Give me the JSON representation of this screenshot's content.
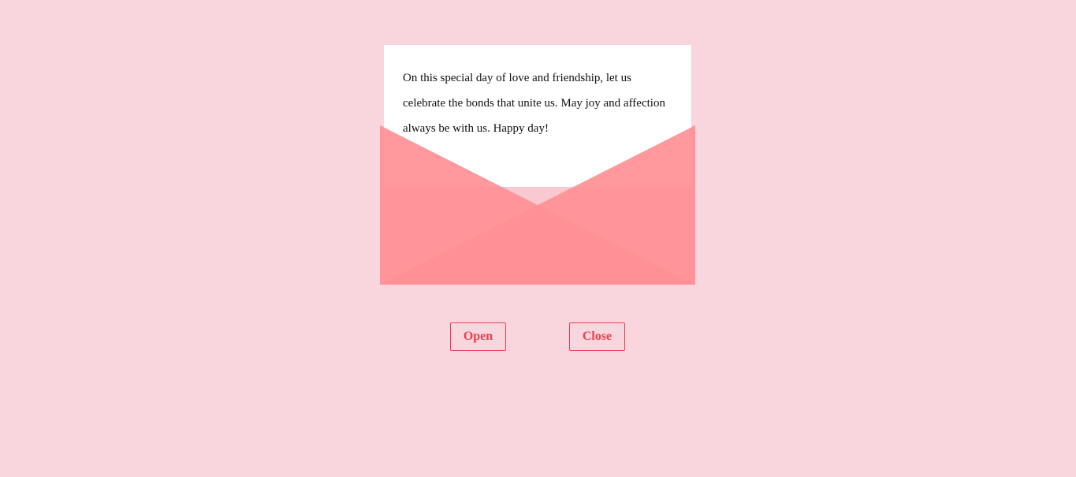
{
  "letter": {
    "message": "On this special day of love and friendship, let us celebrate the bonds that unite us. May joy and affection always be with us. Happy day!"
  },
  "controls": {
    "open_label": "Open",
    "close_label": "Close"
  },
  "colors": {
    "background": "#f9d5dd",
    "envelope_flap": "#ff9aa0",
    "envelope_bottom": "#ff8a8e",
    "letter": "#ffffff",
    "button_accent": "#e8404f"
  }
}
